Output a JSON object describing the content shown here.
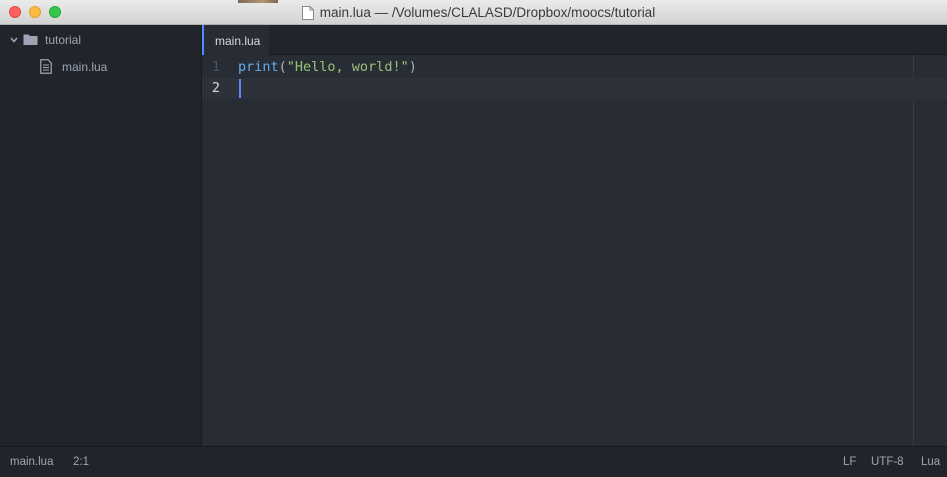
{
  "window": {
    "title": "main.lua — /Volumes/CLALASD/Dropbox/moocs/tutorial"
  },
  "sidebar": {
    "folder": {
      "label": "tutorial",
      "icon": "folder-icon",
      "expanded": true
    },
    "files": [
      {
        "label": "main.lua",
        "icon": "file-text-icon"
      }
    ]
  },
  "tabs": [
    {
      "label": "main.lua",
      "active": true
    }
  ],
  "editor": {
    "lines": [
      {
        "number": "1",
        "tokens": {
          "fn": "print",
          "open": "(",
          "str": "\"Hello, world!\"",
          "close": ")"
        }
      },
      {
        "number": "2",
        "text": ""
      }
    ]
  },
  "status": {
    "file": "main.lua",
    "cursor": "2:1",
    "line_ending": "LF",
    "encoding": "UTF-8",
    "grammar": "Lua"
  },
  "colors": {
    "accent": "#528bff",
    "function": "#61afef",
    "string": "#98c379",
    "editor_bg": "#282c34",
    "panel_bg": "#21252b"
  }
}
